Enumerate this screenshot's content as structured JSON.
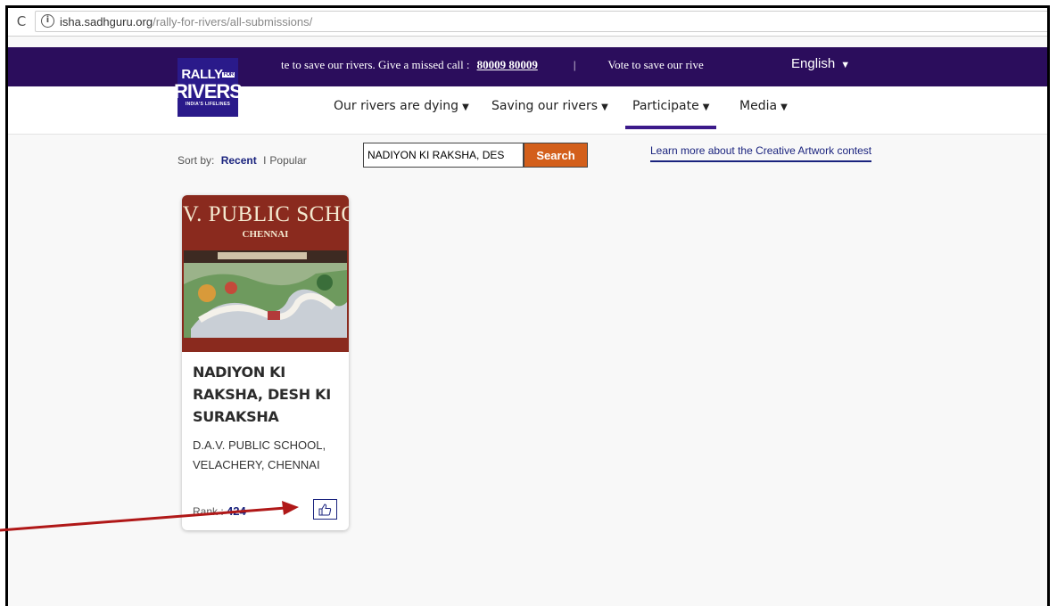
{
  "browser": {
    "url_domain": "isha.sadhguru.org",
    "url_path": "/rally-for-rivers/all-submissions/"
  },
  "topbar": {
    "logo": {
      "line1": "RALLY",
      "line1_small": "FOR",
      "line2": "RIVERS",
      "line3": "INDIA'S LIFELINES"
    },
    "ticker_text": "te to save our rivers. Give a missed call :",
    "phone": "80009 80009",
    "separator": "|",
    "ticker_text2": "Vote to save our rive",
    "language": "English",
    "language_caret": "▼"
  },
  "nav": {
    "items": [
      {
        "label": "Our rivers are dying",
        "caret": "▼"
      },
      {
        "label": "Saving our rivers",
        "caret": "▼"
      },
      {
        "label": "Participate",
        "caret": "▼"
      },
      {
        "label": "Media",
        "caret": "▼"
      }
    ]
  },
  "controls": {
    "sort_label": "Sort by:",
    "sort_recent": "Recent",
    "sort_sep": "I",
    "sort_popular": "Popular",
    "search_value": "NADIYON KI RAKSHA, DES",
    "search_button": "Search",
    "learn_more": "Learn more about the Creative Artwork contest"
  },
  "card": {
    "image_text": ".V. PUBLIC SCHO",
    "image_subtext": "CHENNAI",
    "title": "NADIYON KI RAKSHA, DESH KI SURAKSHA",
    "subtitle": "D.A.V. PUBLIC SCHOOL, VELACHERY, CHENNAI",
    "rank_label": "Rank :",
    "rank_value": "424"
  },
  "colors": {
    "topbar": "#2b0d5c",
    "accent": "#1a237e",
    "search_button": "#d35f1b",
    "arrow": "#b01818"
  }
}
